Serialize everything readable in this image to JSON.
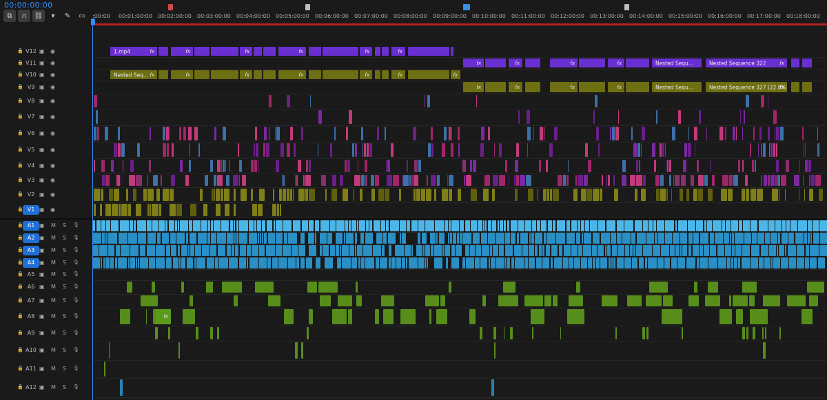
{
  "timecode": "00:00:00:00",
  "toolbar": {
    "tools": [
      {
        "name": "nest-sequences-icon",
        "glyph": "⧉"
      },
      {
        "name": "snap-icon",
        "glyph": "∩"
      },
      {
        "name": "linked-selection-icon",
        "glyph": "⛓"
      },
      {
        "name": "add-marker-icon",
        "glyph": "▾"
      },
      {
        "name": "settings-wrench-icon",
        "glyph": "✎"
      },
      {
        "name": "captions-icon",
        "glyph": "▭"
      }
    ]
  },
  "ruler": {
    "labels": [
      ":00:00",
      "00:01:00:00",
      "00:02:00:00",
      "00:03:00:00",
      "00:04:00:00",
      "00:05:00:00",
      "00:06:00:00",
      "00:07:00:00",
      "00:08:00:00",
      "00:09:00:00",
      "00:10:00:00",
      "00:11:00:00",
      "00:12:00:00",
      "00:13:00:00",
      "00:14:00:00",
      "00:15:00:00",
      "00:16:00:00",
      "00:17:00:00",
      "00:18:00:00"
    ],
    "markers": [
      {
        "name": "sequence-marker-red",
        "color": "#d24a4a"
      },
      {
        "name": "sequence-marker-grey-1",
        "color": "#bdbdbd"
      },
      {
        "name": "sequence-marker-blue",
        "color": "#3a8ee6"
      },
      {
        "name": "sequence-marker-grey-2",
        "color": "#bdbdbd"
      }
    ]
  },
  "tracks": {
    "video": [
      {
        "name": "V12",
        "active": false
      },
      {
        "name": "V11",
        "active": false
      },
      {
        "name": "V10",
        "active": false
      },
      {
        "name": "V9",
        "active": false
      },
      {
        "name": "V8",
        "active": false
      },
      {
        "name": "V7",
        "active": false
      },
      {
        "name": "V6",
        "active": false
      },
      {
        "name": "V5",
        "active": false
      },
      {
        "name": "V4",
        "active": false
      },
      {
        "name": "V3",
        "active": false
      },
      {
        "name": "V2",
        "active": false
      },
      {
        "name": "V1",
        "active": true
      }
    ],
    "audio": [
      {
        "name": "A1",
        "active": true
      },
      {
        "name": "A2",
        "active": true
      },
      {
        "name": "A3",
        "active": true
      },
      {
        "name": "A4",
        "active": true
      },
      {
        "name": "A5",
        "active": false
      },
      {
        "name": "A6",
        "active": false
      },
      {
        "name": "A7",
        "active": false
      },
      {
        "name": "A8",
        "active": false
      },
      {
        "name": "A9",
        "active": false
      },
      {
        "name": "A10",
        "active": false
      },
      {
        "name": "A11",
        "active": false
      },
      {
        "name": "A12",
        "active": false
      }
    ],
    "mute_label": "M",
    "solo_label": "S"
  },
  "clips": {
    "v12_first": "1.mp4",
    "v10_first": "Nested Seq...",
    "v11_nested_a": "Nested Sequ...",
    "v11_nested_b": "Nested Sequence 322",
    "v9_nested_a": "Nested Sequ...",
    "v9_nested_b": "Nested Sequence 327 [22.8%]",
    "fx": "fx"
  },
  "colors": {
    "purple_clip": "#6a2fd0",
    "olive_clip": "#6e6e12",
    "audio_blue": "#2a8fc4",
    "audio_green": "#5d9a1c",
    "accent_blue": "#2f8fff"
  }
}
